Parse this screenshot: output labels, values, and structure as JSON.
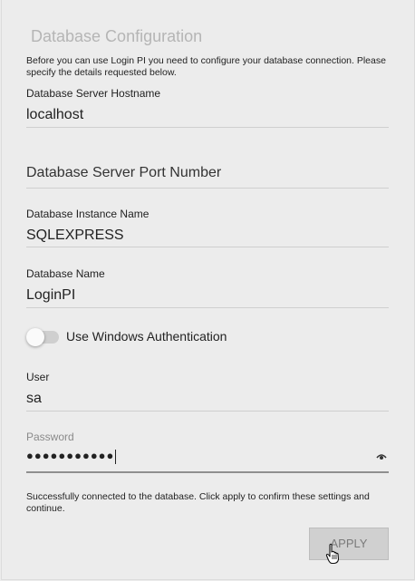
{
  "page": {
    "title": "Database Configuration",
    "intro": "Before you can use Login PI you need to configure your database connection. Please specify the details requested below."
  },
  "fields": {
    "hostname": {
      "label": "Database Server Hostname",
      "value": "localhost"
    },
    "port": {
      "label": "",
      "placeholder": "Database Server Port Number",
      "value": ""
    },
    "instance": {
      "label": "Database Instance Name",
      "value": "SQLEXPRESS"
    },
    "dbname": {
      "label": "Database Name",
      "value": "LoginPI"
    },
    "user": {
      "label": "User",
      "value": "sa"
    },
    "password": {
      "label": "Password",
      "masked": "●●●●●●●●●●●"
    }
  },
  "toggle": {
    "label": "Use Windows Authentication",
    "checked": false
  },
  "status": "Successfully connected to the database. Click apply to confirm these settings and continue.",
  "buttons": {
    "apply": "APPLY"
  },
  "icons": {
    "password_toggle": "eye-icon",
    "pointer": "hand-cursor-icon"
  },
  "colors": {
    "background": "#ececec",
    "title": "#b5b5b5",
    "button": "#d0d0d0"
  }
}
